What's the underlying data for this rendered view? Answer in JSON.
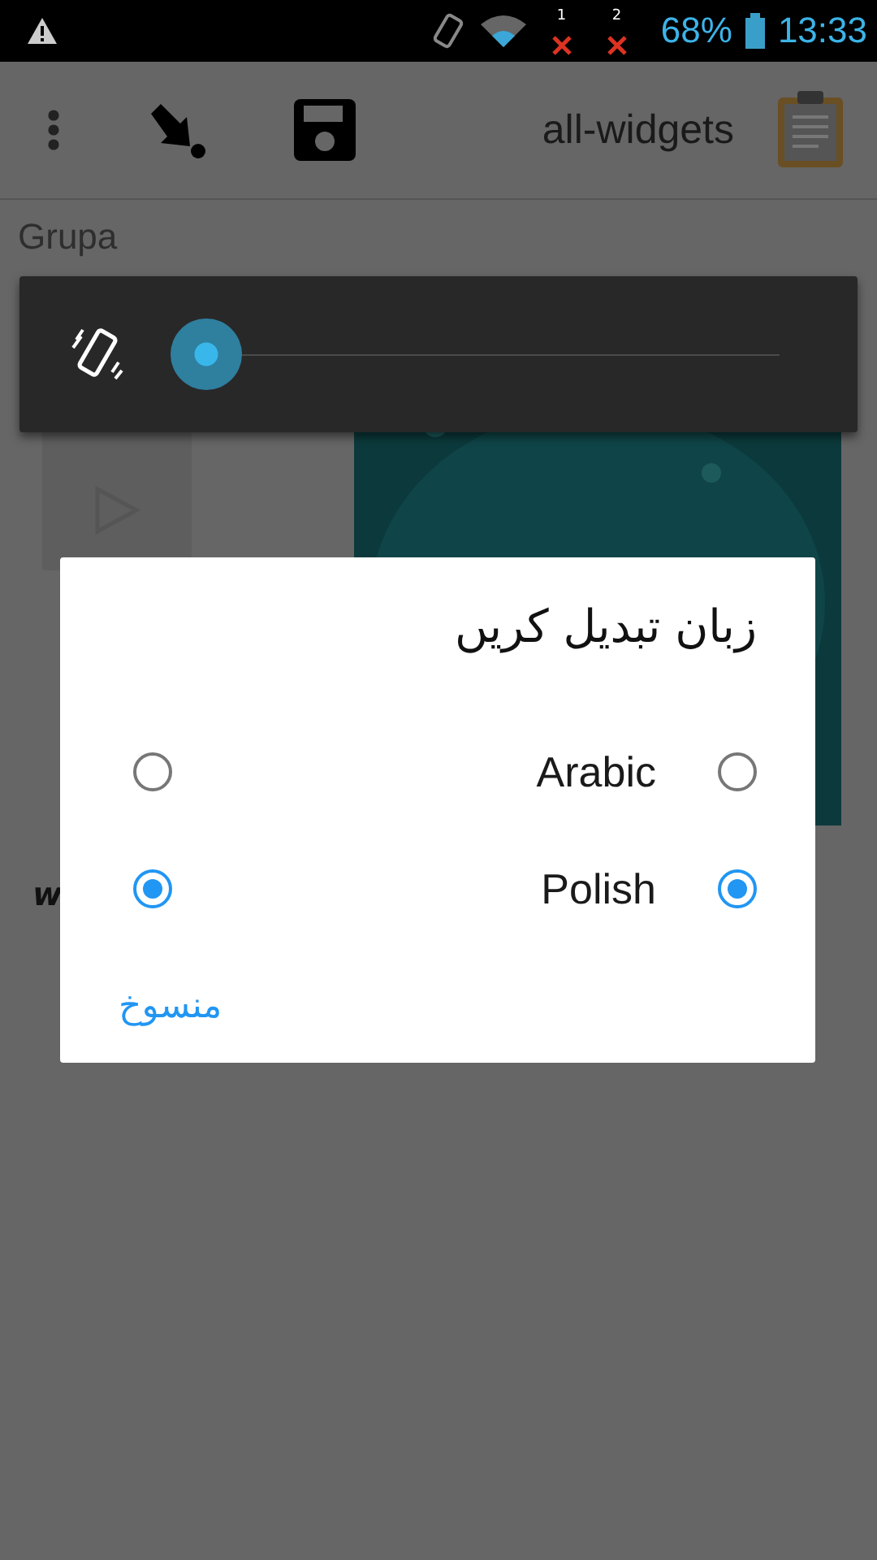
{
  "status_bar": {
    "sim_labels": [
      "1",
      "2"
    ],
    "battery": "68%",
    "time": "13:33"
  },
  "toolbar": {
    "title": "all-widgets"
  },
  "group_label": "Grupa",
  "partial_label": "w",
  "volume_panel": {
    "level": 0
  },
  "dialog": {
    "title": "زبان تبدیل کریں",
    "options": [
      {
        "label": "Arabic",
        "selected": false
      },
      {
        "label": "Polish",
        "selected": true
      }
    ],
    "cancel": "منسوخ"
  }
}
